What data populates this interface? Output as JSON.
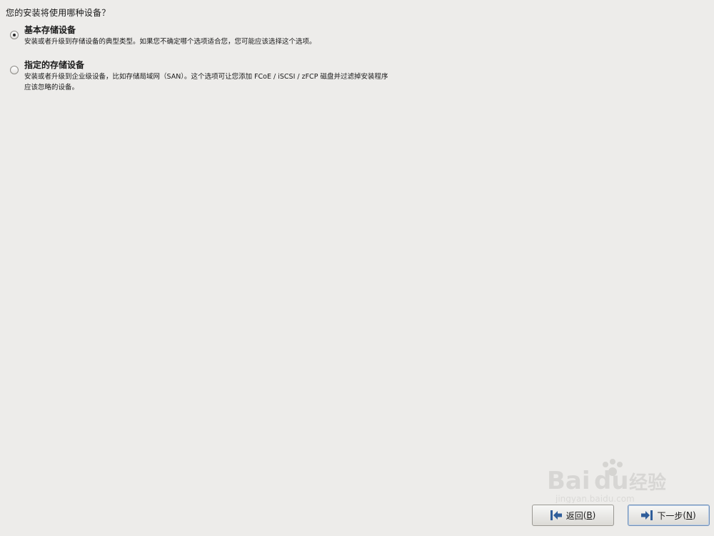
{
  "question": "您的安装将使用哪种设备？",
  "options": [
    {
      "title": "基本存储设备",
      "desc_lines": [
        "安装或者升级到存储设备的典型类型。如果您不确定哪个选项适合您，您可能应该选择这个选项。"
      ],
      "selected": true
    },
    {
      "title": "指定的存储设备",
      "desc_lines": [
        "安装或者升级到企业级设备，比如存储局域网（SAN）。这个选项可让您添加 FCoE / iSCSI / zFCP 磁盘并过滤掉安装程序",
        "应该忽略的设备。"
      ],
      "selected": false
    }
  ],
  "buttons": {
    "back": {
      "label": "返回",
      "mnemonic_prefix": " (",
      "mnemonic": "B",
      "mnemonic_suffix": ")"
    },
    "next": {
      "label": "下一步",
      "mnemonic_prefix": " (",
      "mnemonic": "N",
      "mnemonic_suffix": ")"
    }
  },
  "watermark": {
    "text": "Baidu经验",
    "sub": "jingyan.baidu.com"
  },
  "colors": {
    "background": "#edecea",
    "arrow": "#2f5d9a"
  }
}
